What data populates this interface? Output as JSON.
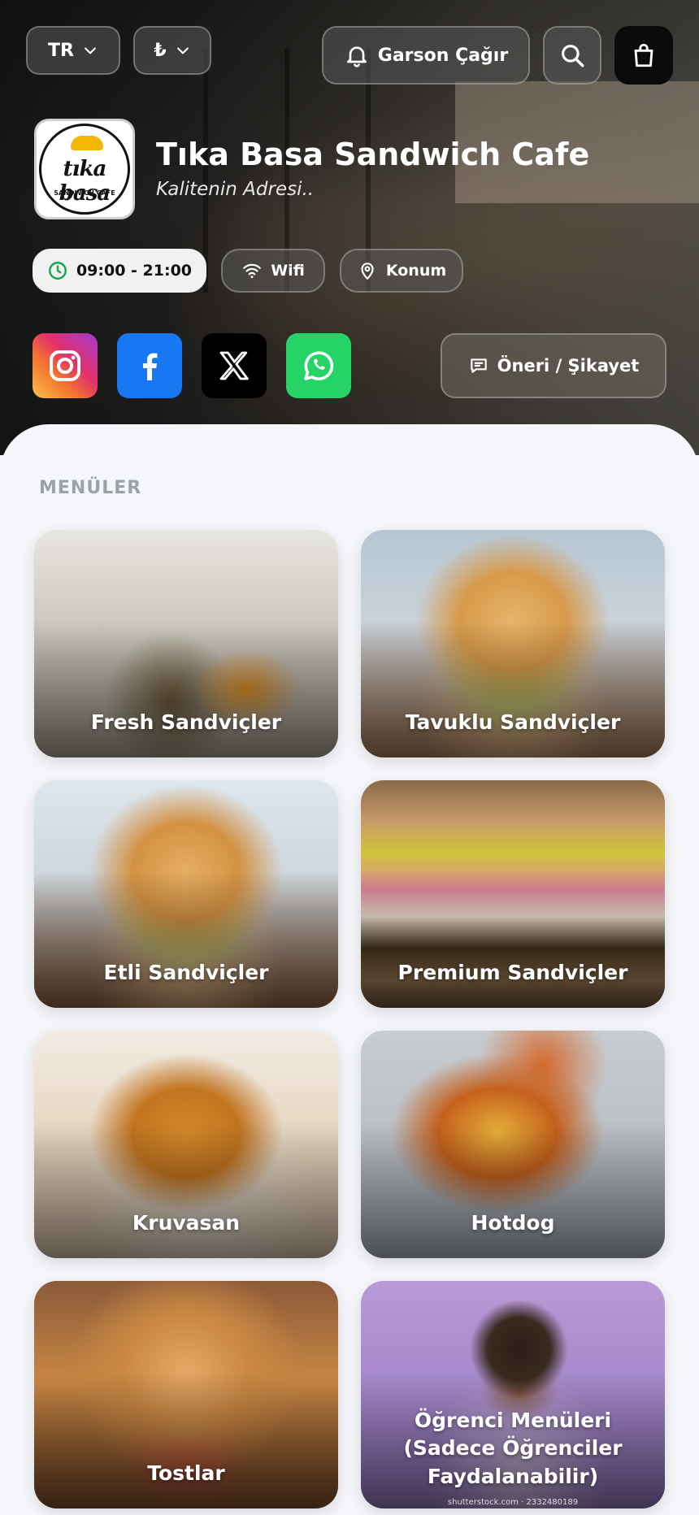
{
  "header": {
    "language": "TR",
    "currency": "₺",
    "call_waiter_label": "Garson Çağır"
  },
  "restaurant": {
    "logo_text": "tıka basa",
    "logo_subtext": "SANDWICH CAFE",
    "name": "Tıka Basa Sandwich Cafe",
    "tagline": "Kalitenin Adresi.."
  },
  "info": {
    "hours": "09:00 - 21:00",
    "wifi_label": "Wifi",
    "location_label": "Konum"
  },
  "social": {
    "feedback_label": "Öneri / Şikayet"
  },
  "menu": {
    "section_title": "MENÜLER",
    "items": [
      {
        "label": "Fresh Sandviçler"
      },
      {
        "label": "Tavuklu Sandviçler"
      },
      {
        "label": "Etli Sandviçler"
      },
      {
        "label": "Premium Sandviçler"
      },
      {
        "label": "Kruvasan"
      },
      {
        "label": "Hotdog"
      },
      {
        "label": "Tostlar"
      },
      {
        "label": "Öğrenci Menüleri (Sadece Öğrenciler Faydalanabilir)"
      }
    ],
    "watermark": "shutterstock.com · 2332480189"
  },
  "colors": {
    "facebook": "#1877f2",
    "whatsapp": "#25d366",
    "x": "#000000",
    "instagram_from": "#f9c24a",
    "instagram_to": "#a33bd1"
  }
}
